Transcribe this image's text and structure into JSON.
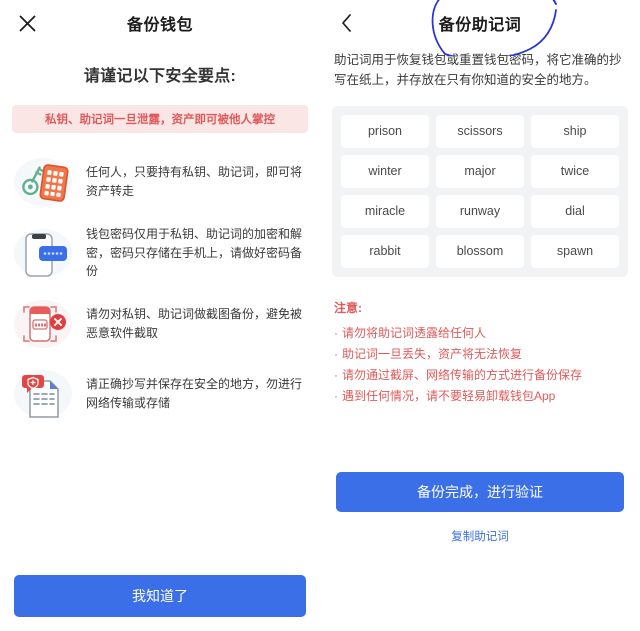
{
  "left": {
    "close_icon": "close-icon",
    "title": "备份钱包",
    "lead_title": "请谨记以下安全要点:",
    "alert": "私钥、助记词一旦泄露，资产即可被他人掌控",
    "tips": [
      {
        "icon": "key-and-card-icon",
        "text": "任何人，只要持有私钥、助记词，即可将资产转走"
      },
      {
        "icon": "phone-password-icon",
        "text": "钱包密码仅用于私钥、助记词的加密和解密，密码只存储在手机上，请做好密码备份"
      },
      {
        "icon": "no-screenshot-icon",
        "text": "请勿对私钥、助记词做截图备份，避免被恶意软件截取"
      },
      {
        "icon": "secure-document-icon",
        "text": "请正确抄写并保存在安全的地方，勿进行网络传输或存储"
      }
    ],
    "confirm_button": "我知道了"
  },
  "right": {
    "back_icon": "chevron-left-icon",
    "title": "备份助记词",
    "annotation_icon": "handdrawn-circle-annotation",
    "description": "助记词用于恢复钱包或重置钱包密码，将它准确的抄写在纸上，并存放在只有你知道的安全的地方。",
    "mnemonic_words": [
      "prison",
      "scissors",
      "ship",
      "winter",
      "major",
      "twice",
      "miracle",
      "runway",
      "dial",
      "rabbit",
      "blossom",
      "spawn"
    ],
    "note_title": "注意:",
    "notes": [
      "请勿将助记词透露给任何人",
      "助记词一旦丢失，资产将无法恢复",
      "请勿通过截屏、网络传输的方式进行备份保存",
      "遇到任何情况，请不要轻易卸载钱包App"
    ],
    "verify_button": "备份完成，进行验证",
    "copy_link": "复制助记词"
  },
  "colors": {
    "primary": "#3b6fe8",
    "danger": "#e05a5a",
    "alert_bg": "#fbe6e6",
    "grid_bg": "#f2f3f5",
    "annotation": "#2b35d6"
  }
}
